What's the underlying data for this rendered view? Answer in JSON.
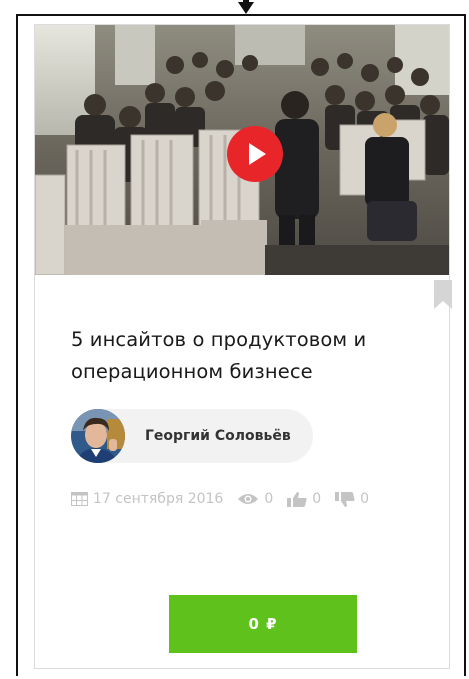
{
  "course": {
    "title": "5 инсайтов о продуктовом и операционном бизнесе",
    "author": {
      "name": "Георгий Соловьёв"
    },
    "meta": {
      "date": "17 сентября 2016",
      "views": "0",
      "likes": "0",
      "dislikes": "0"
    },
    "price_label": "0 ₽"
  },
  "icons": {
    "play": "play-icon",
    "bookmark": "bookmark-icon",
    "calendar": "calendar-icon",
    "views": "eye-icon",
    "likes": "thumbs-up-icon",
    "dislikes": "thumbs-down-icon"
  },
  "colors": {
    "buy_button": "#5fc11b",
    "play_button": "#e8262a",
    "meta_text": "#c4c4c4"
  }
}
